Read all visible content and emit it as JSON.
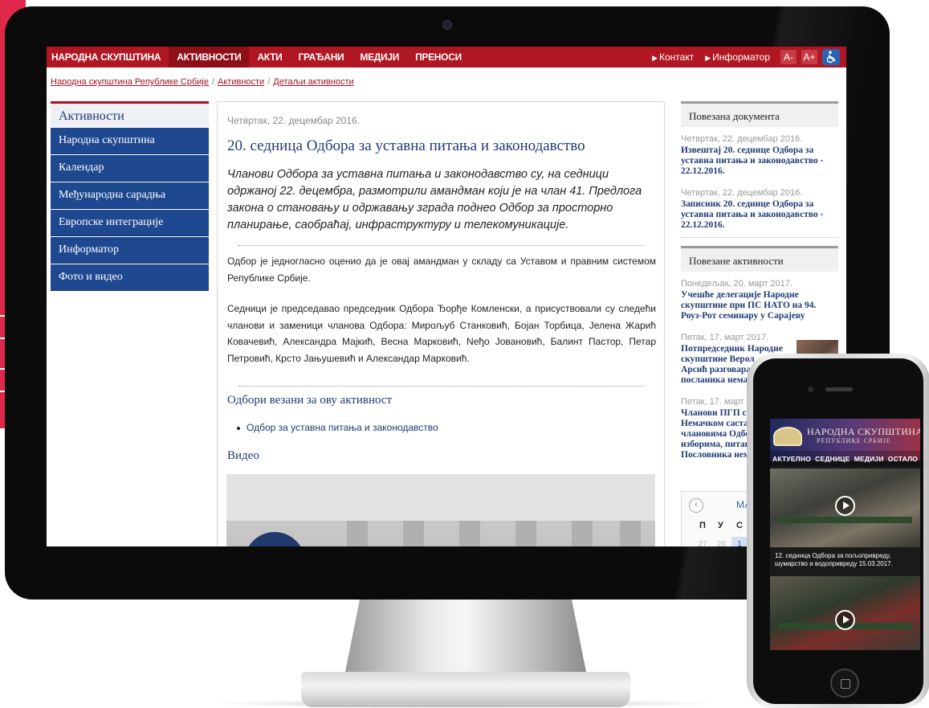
{
  "topnav": {
    "items": [
      "НАРОДНА СКУПШТИНА",
      "АКТИВНОСТИ",
      "АКТИ",
      "ГРАЂАНИ",
      "МЕДИЈИ",
      "ПРЕНОСИ"
    ],
    "active_index": 1,
    "contact": "Контакт",
    "informator": "Информатор",
    "font_decrease": "A-",
    "font_increase": "A+",
    "accessibility_icon": "wheelchair-icon"
  },
  "breadcrumb": {
    "items": [
      "Народна скупштина Републике Србије",
      "Активности",
      "Детаљи активности"
    ],
    "separator": "/"
  },
  "sidebar": {
    "title": "Активности",
    "items": [
      "Народна скупштина",
      "Календар",
      "Међународна сарадња",
      "Европске интеграције",
      "Информатор",
      "Фото и видео"
    ]
  },
  "article": {
    "date": "Четвртак, 22. децембар 2016.",
    "title": "20. седница Одбора за уставна питања и законодавство",
    "lead": "Чланови Одбора за уставна питања и законодавство су, на седници одржаној 22. децембра, размотрили амандман који је на члан 41. Предлога закона о становању и одржавању зграда поднео Одбор за просторно планирање, саобраћај, инфраструктуру и телекомуникације.",
    "p1": "Одбор је једногласно оценио да је овај амандман у складу са Уставом и правним системом Републике Србије.",
    "p2": "Седници је председавао председник Одбора Ђорђе Комленски, а присуствовали су следећи чланови и заменици чланова Одбора: Мирољуб Станковић, Бојан Торбица, Јелена Жарић Ковачевић, Александра Мајкић, Весна Марковић, Neђо Јовановић, Балинт Пастор, Петар Петровић, Крсто Јањушевић и Александар Марковић.",
    "committees_heading": "Одбори везани за ову активност",
    "committee_link": "Одбор за уставна питања и законодавство",
    "video_heading": "Видео"
  },
  "related_docs": {
    "heading": "Повезана документа",
    "items": [
      {
        "date": "Четвртак, 22. децембар 2016.",
        "title": "Извештај 20. седнице Одбора за\nуставна питања и законодавство -\n22.12.2016."
      },
      {
        "date": "Четвртак, 22. децембар 2016.",
        "title": "Записник 20. седнице Одбора за\nуставна питања и законодавство -\n22.12.2016."
      }
    ]
  },
  "related_activities": {
    "heading": "Повезане активности",
    "items": [
      {
        "date": "Понедељак, 20. март 2017.",
        "title": "Учешће делегације Народне\nскупштине при ПС НАТО на 94.\nРоуз-Рот семинару у Сарајеву"
      },
      {
        "date": "Петак, 17. март 2017.",
        "title": "Потпредседник Народне\nскупштине Верол\nАрсић разговара\nпосланика немач"
      },
      {
        "date": "Петак, 17. март 2",
        "title": "Чланови ПГП са\nНемачком састав\nчлановима Одбо\nизборима, питан\nПословника нем"
      }
    ]
  },
  "calendar": {
    "month": "МАР",
    "prev_icon": "chevron-left-icon",
    "weekdays": [
      "П",
      "У",
      "С"
    ],
    "days": [
      "27",
      "28",
      "1"
    ],
    "selected_day": "1"
  },
  "phone": {
    "title": "НАРОДНА СКУПШТИНА",
    "subtitle": "РЕПУБЛИКЕ СРБИЈЕ",
    "nav": [
      "АКТУЕЛНО",
      "СЕДНИЦЕ",
      "МЕДИЈИ",
      "ОСТАЛО"
    ],
    "video1_caption": "12. седница Одбора за пољопривреду, шумарство и водопривреду 15.03.2017.",
    "play_icon": "play-icon"
  },
  "colors": {
    "accent": "#e0284b",
    "nav_red": "#b01722",
    "sidebar_blue": "#1e4890",
    "link_blue": "#1d3a73"
  }
}
